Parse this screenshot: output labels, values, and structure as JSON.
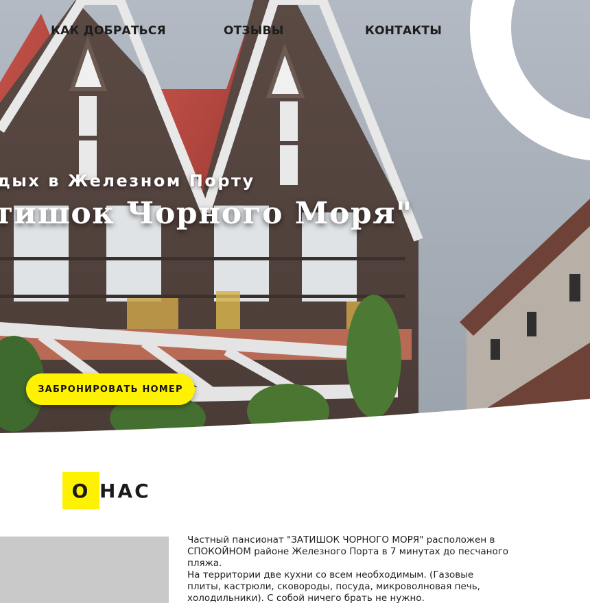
{
  "nav": {
    "items": [
      {
        "label": "КАК ДОБРАТЬСЯ"
      },
      {
        "label": "ОТЗЫВЫ"
      },
      {
        "label": "КОНТАКТЫ"
      }
    ]
  },
  "hero": {
    "subtitle": "Отдых в Железном Порту",
    "title": "\"Затишок Чорного Моря\"",
    "book_button": "ЗАБРОНИРОВАТЬ НОМЕР"
  },
  "about": {
    "heading_highlight": "О",
    "heading_rest": " НАС",
    "paragraphs": [
      "Частный пансионат \"ЗАТИШОК ЧОРНОГО МОРЯ\" расположен в СПОКОЙНОМ районе Железного Порта в 7 минутах до песчаного пляжа.",
      "На территории две кухни со всем необходимым. (Газовые плиты, кастрюли, сковороды, посуда, микроволновая печь, холодильники). С собой ничего брать не нужно."
    ]
  },
  "colors": {
    "accent": "#fff200",
    "hero_text": "#ffffff",
    "nav_text": "#1d1d1d"
  }
}
